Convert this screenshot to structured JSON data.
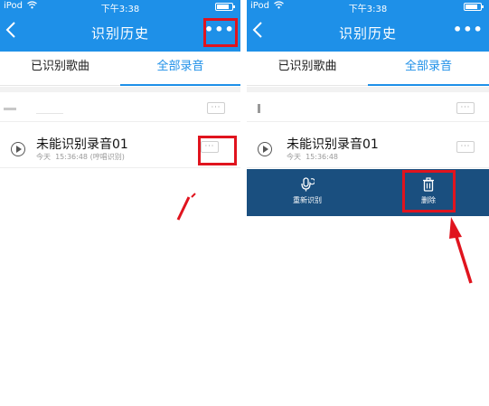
{
  "status_bar": {
    "carrier": "iPod",
    "wifi": "wifi-icon",
    "time": "下午3:38",
    "battery": "battery-icon"
  },
  "nav": {
    "title": "识别历史",
    "back_icon": "chevron-left-icon",
    "more": "•••"
  },
  "tabs": [
    {
      "label": "已识别歌曲",
      "active": false
    },
    {
      "label": "全部录音",
      "active": true
    }
  ],
  "recording": {
    "name": "未能识别录音01",
    "date": "今天",
    "time": "15:36:48",
    "mode": "(哼唱识别)",
    "more": "···"
  },
  "faded_row": {
    "more": "···"
  },
  "actions": [
    {
      "label": "重新识别",
      "icon": "mic-refresh-icon"
    },
    {
      "label": "删除",
      "icon": "trash-icon"
    }
  ],
  "colors": {
    "primary": "#1e90e8",
    "panel": "#1a4f7f",
    "highlight": "#e0141e"
  }
}
